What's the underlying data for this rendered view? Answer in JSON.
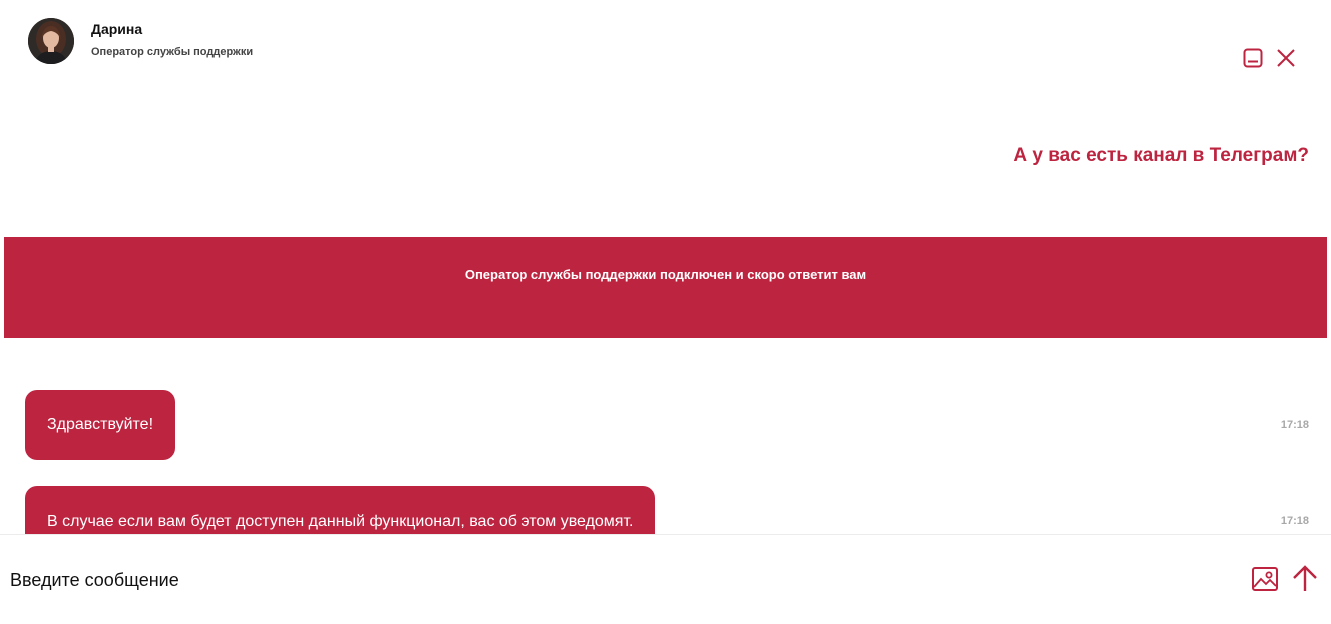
{
  "header": {
    "operator_name": "Дарина",
    "operator_role": "Оператор службы поддержки"
  },
  "question_link": "А у вас есть канал в Телеграм?",
  "banner": {
    "text": "Оператор службы поддержки подключен и скоро ответит вам"
  },
  "messages": [
    {
      "text": "Здравствуйте!",
      "time": "17:18"
    },
    {
      "text": "В случае если вам будет доступен данный функционал, вас об этом уведомят.",
      "time": "17:18"
    }
  ],
  "composer": {
    "placeholder": "Введите сообщение"
  },
  "colors": {
    "accent": "#bc2440"
  },
  "icons": {
    "minimize": "minimize-icon",
    "close": "close-icon",
    "attach": "image-icon",
    "send": "arrow-up-icon"
  }
}
